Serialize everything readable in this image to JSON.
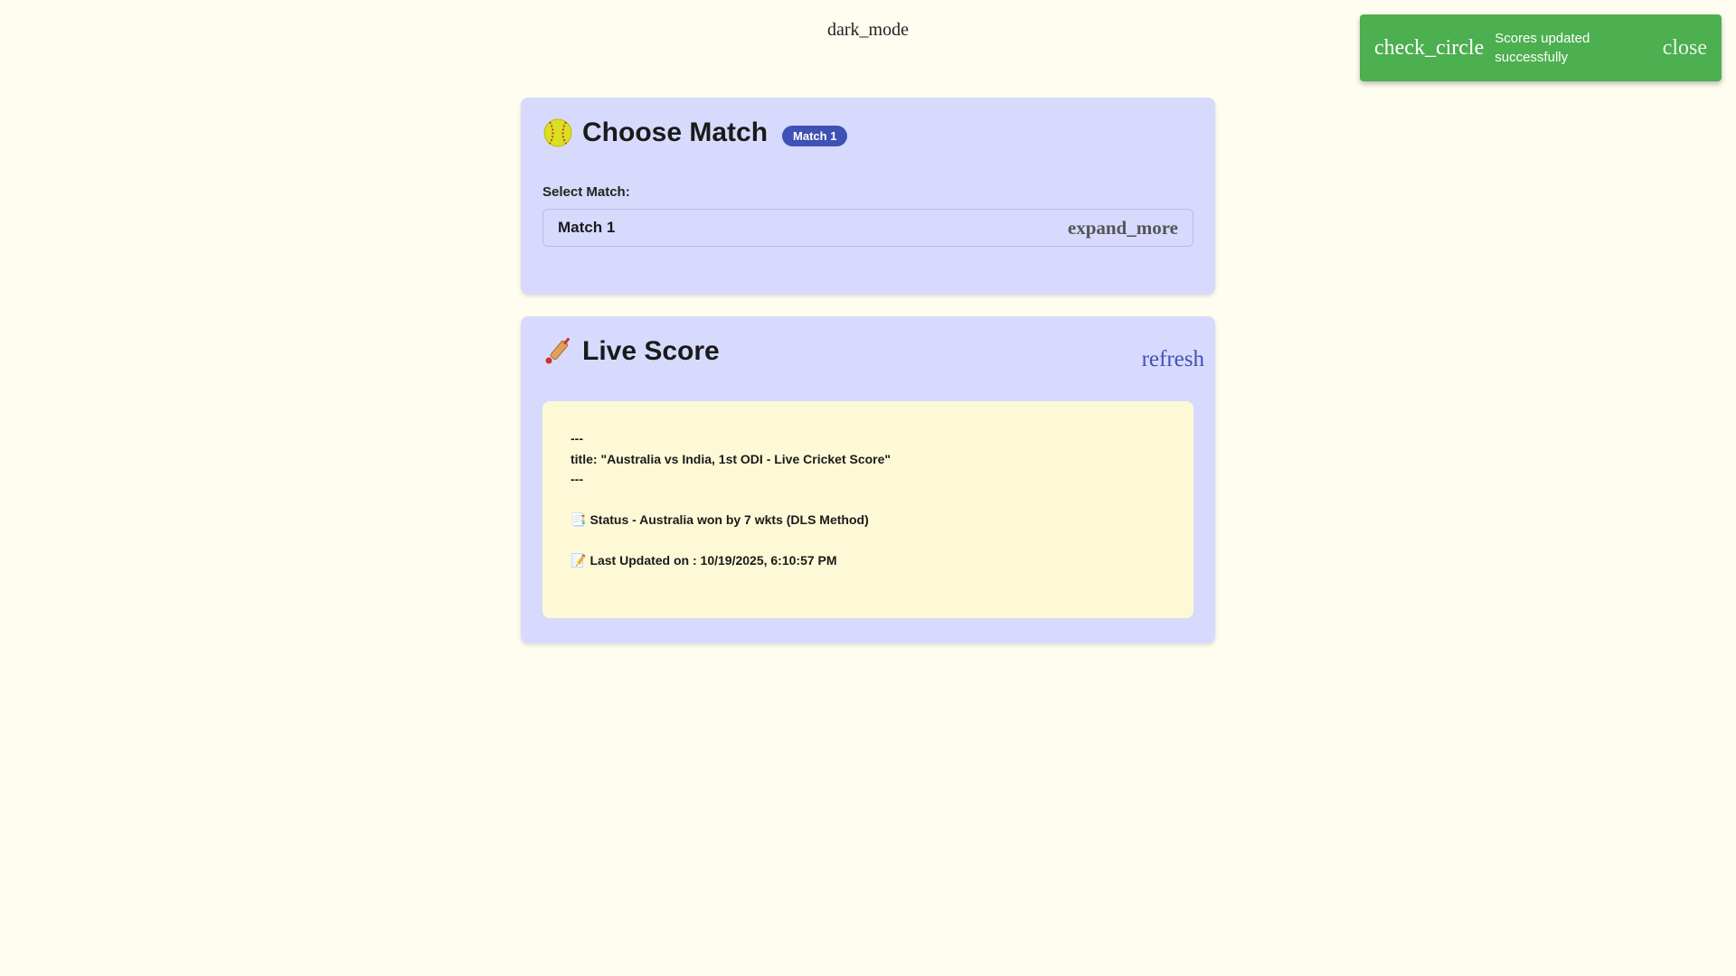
{
  "header": {
    "theme_toggle_label": "dark_mode"
  },
  "toast": {
    "icon_label": "check_circle",
    "message": "Scores updated successfully",
    "close_label": "close",
    "color": "#4caf50"
  },
  "match_card": {
    "emoji": "🥎",
    "title": "Choose Match",
    "badge": "Match 1",
    "select_label": "Select Match:",
    "selected_value": "Match 1",
    "select_arrow_label": "expand_more"
  },
  "score_card": {
    "emoji": "🏏",
    "title": "Live Score",
    "refresh_label": "refresh",
    "front_matter_open": "---",
    "front_matter_title": "title: \"Australia vs India, 1st ODI - Live Cricket Score\"",
    "front_matter_close": "---",
    "status_emoji": "📑",
    "status_text": "Status - Australia won by 7 wkts (DLS Method)",
    "updated_emoji": "📝",
    "updated_text": "Last Updated on : 10/19/2025, 6:10:57 PM"
  },
  "colors": {
    "page_bg": "#fffdf0",
    "card_bg": "#d8dafd",
    "accent": "#3f51b5",
    "score_bg": "#fdf9d6"
  }
}
